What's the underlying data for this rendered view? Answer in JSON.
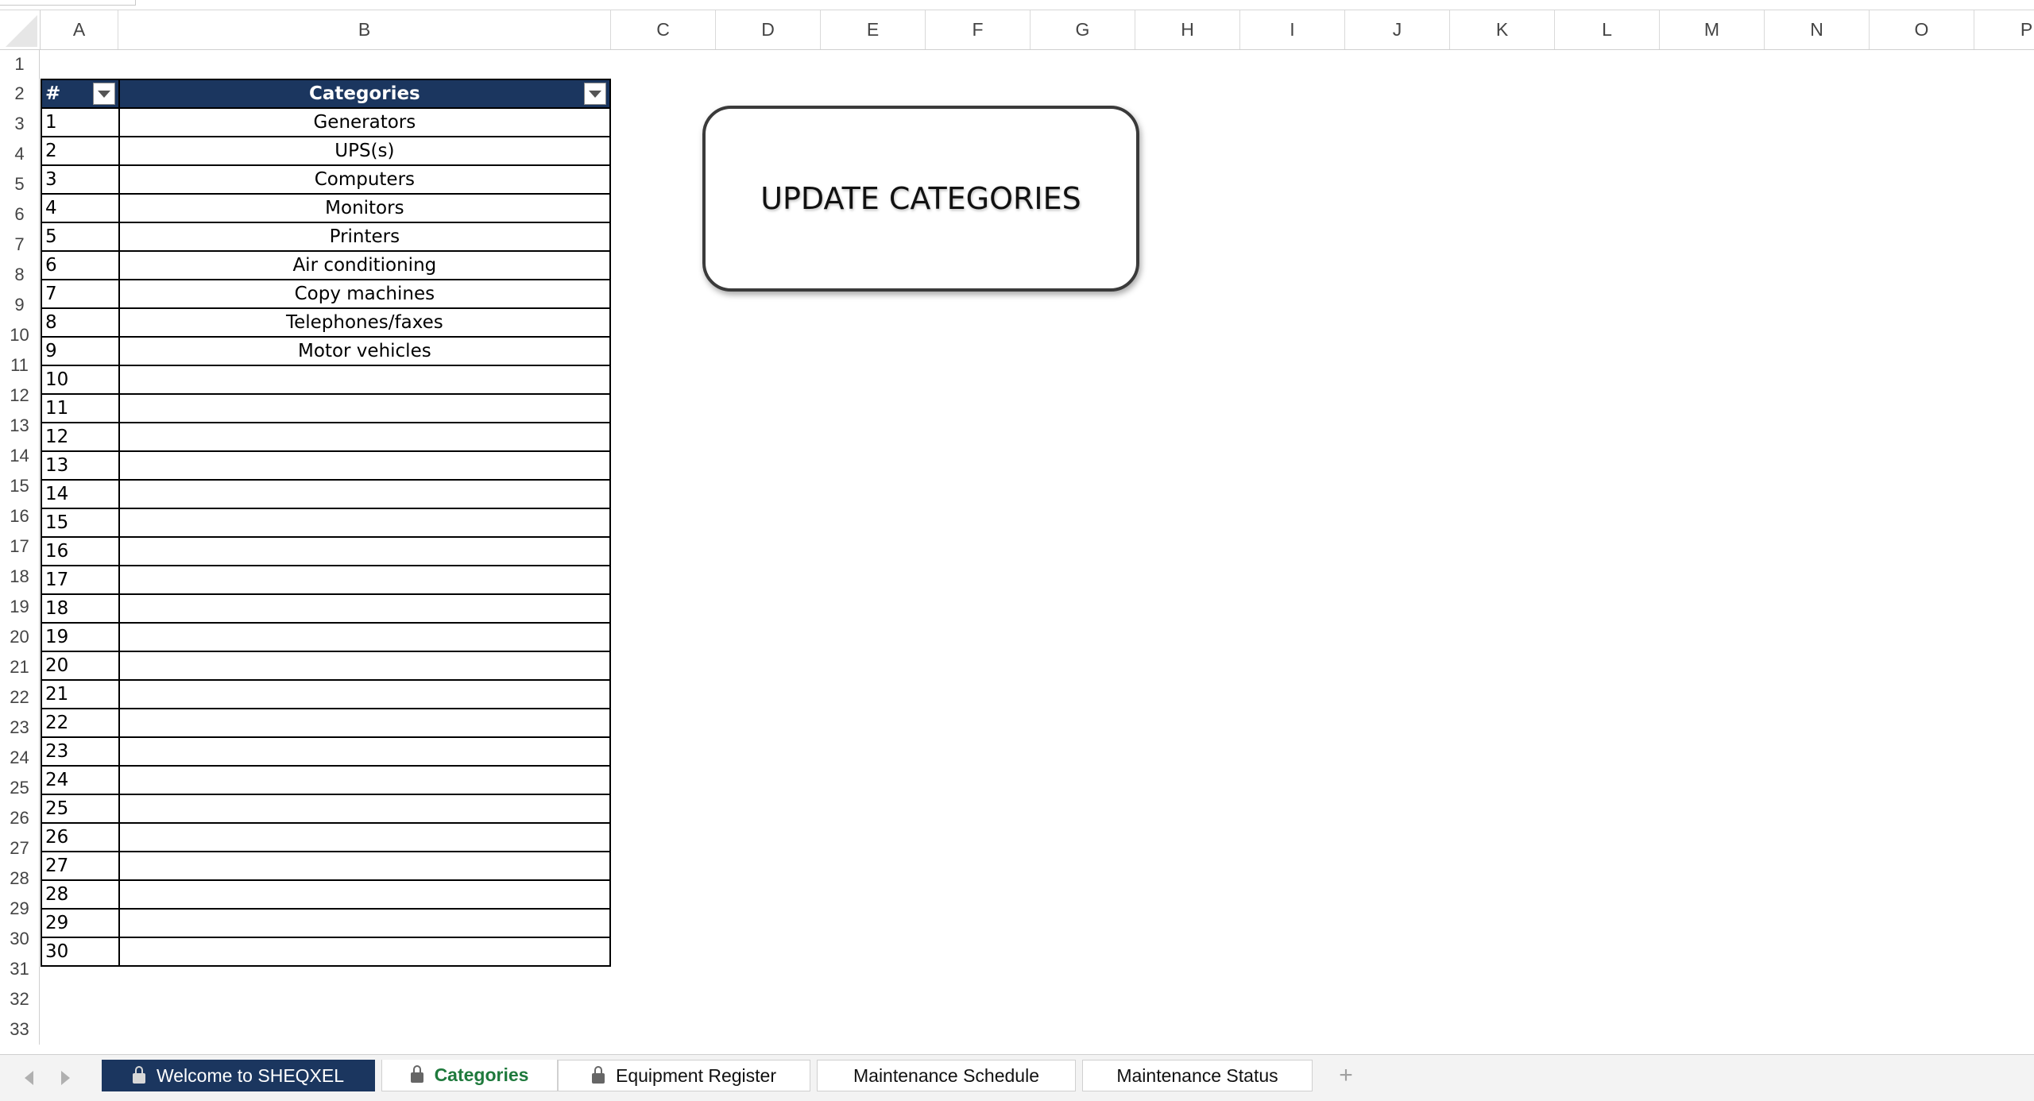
{
  "sheet": {
    "columns": [
      "A",
      "B",
      "C",
      "D",
      "E",
      "F",
      "G",
      "H",
      "I",
      "J",
      "K",
      "L",
      "M",
      "N",
      "O",
      "P"
    ],
    "rows": [
      "1",
      "2",
      "3",
      "4",
      "5",
      "6",
      "7",
      "8",
      "9",
      "10",
      "11",
      "12",
      "13",
      "14",
      "15",
      "16",
      "17",
      "18",
      "19",
      "20",
      "21",
      "22",
      "23",
      "24",
      "25",
      "26",
      "27",
      "28",
      "29",
      "30",
      "31",
      "32",
      "33"
    ]
  },
  "table": {
    "headers": {
      "num": "#",
      "category": "Categories"
    },
    "rows": [
      {
        "num": "1",
        "category": "Generators"
      },
      {
        "num": "2",
        "category": "UPS(s)"
      },
      {
        "num": "3",
        "category": "Computers"
      },
      {
        "num": "4",
        "category": "Monitors"
      },
      {
        "num": "5",
        "category": "Printers"
      },
      {
        "num": "6",
        "category": "Air conditioning"
      },
      {
        "num": "7",
        "category": "Copy machines"
      },
      {
        "num": "8",
        "category": "Telephones/faxes"
      },
      {
        "num": "9",
        "category": "Motor vehicles"
      },
      {
        "num": "10",
        "category": ""
      },
      {
        "num": "11",
        "category": ""
      },
      {
        "num": "12",
        "category": ""
      },
      {
        "num": "13",
        "category": ""
      },
      {
        "num": "14",
        "category": ""
      },
      {
        "num": "15",
        "category": ""
      },
      {
        "num": "16",
        "category": ""
      },
      {
        "num": "17",
        "category": ""
      },
      {
        "num": "18",
        "category": ""
      },
      {
        "num": "19",
        "category": ""
      },
      {
        "num": "20",
        "category": ""
      },
      {
        "num": "21",
        "category": ""
      },
      {
        "num": "22",
        "category": ""
      },
      {
        "num": "23",
        "category": ""
      },
      {
        "num": "24",
        "category": ""
      },
      {
        "num": "25",
        "category": ""
      },
      {
        "num": "26",
        "category": ""
      },
      {
        "num": "27",
        "category": ""
      },
      {
        "num": "28",
        "category": ""
      },
      {
        "num": "29",
        "category": ""
      },
      {
        "num": "30",
        "category": ""
      }
    ]
  },
  "update_button": {
    "label": "UPDATE CATEGORIES"
  },
  "tabs": [
    {
      "label": "Welcome to SHEQXEL",
      "locked": true,
      "style": "dark"
    },
    {
      "label": "Categories",
      "locked": true,
      "style": "active"
    },
    {
      "label": "Equipment Register",
      "locked": true,
      "style": "normal"
    },
    {
      "label": "Maintenance Schedule",
      "locked": false,
      "style": "normal"
    },
    {
      "label": "Maintenance Status",
      "locked": false,
      "style": "normal"
    }
  ],
  "add_tab": {
    "label": "+"
  },
  "colors": {
    "header_bg": "#1b365f",
    "active_tab_text": "#1f7a3d"
  },
  "icons": {
    "filter": "dropdown-filter-icon",
    "lock": "lock-icon",
    "nav_prev": "chevron-left-icon",
    "nav_next": "chevron-right-icon",
    "add": "plus-icon"
  }
}
